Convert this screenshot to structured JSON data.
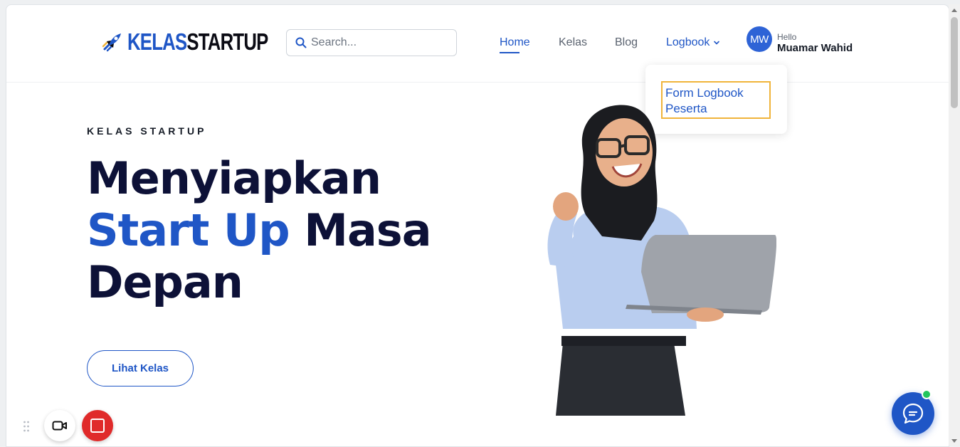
{
  "brand": {
    "kelas": "KELAS",
    "startup": "STARTUP",
    "icon": "rocket-icon"
  },
  "search": {
    "placeholder": "Search...",
    "value": "",
    "icon": "search-icon"
  },
  "nav": {
    "items": [
      {
        "label": "Home",
        "active": true
      },
      {
        "label": "Kelas",
        "active": false
      },
      {
        "label": "Blog",
        "active": false
      },
      {
        "label": "Logbook",
        "active": false,
        "icon": "chevron-down-icon"
      }
    ]
  },
  "user": {
    "initials": "MW",
    "greeting": "Hello",
    "name": "Muamar Wahid"
  },
  "dropdown": {
    "items": [
      {
        "label_line1": "Form Logbook",
        "label_line2": "Peserta"
      }
    ]
  },
  "hero": {
    "eyebrow": "KELAS STARTUP",
    "line1": "Menyiapkan",
    "line2_accent": "Start Up",
    "line2_rest": "Masa",
    "line3": "Depan",
    "button": "Lihat Kelas"
  },
  "widgets": {
    "camera": "camera-icon",
    "stop": "stop-record-icon",
    "chat": "chat-icon",
    "chat_online": true
  },
  "colors": {
    "accent": "#1f56c6",
    "heading": "#0d1137",
    "highlight": "#f0b43a",
    "record": "#e02a2a"
  }
}
